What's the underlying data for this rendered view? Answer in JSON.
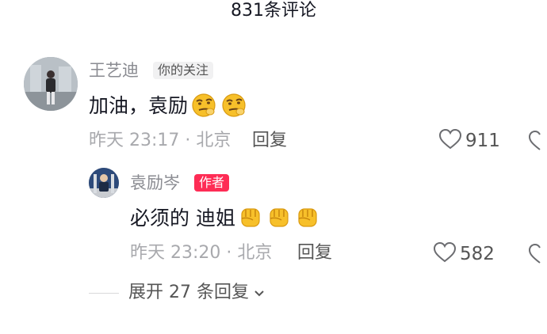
{
  "header": {
    "title": "831条评论"
  },
  "comments": [
    {
      "username": "王艺迪",
      "badge": "你的关注",
      "text": "加油，袁励",
      "emoji_icons": [
        "smirk-emoji-icon",
        "smirk-emoji-icon"
      ],
      "timestamp": "昨天 23:17 · 北京",
      "reply_label": "回复",
      "likes": "911"
    }
  ],
  "replies": [
    {
      "username": "袁励岑",
      "badge": "作者",
      "text": "必须的 迪姐",
      "emoji_icons": [
        "raised-fist-icon",
        "raised-fist-icon",
        "raised-fist-icon"
      ],
      "timestamp": "昨天 23:20 · 北京",
      "reply_label": "回复",
      "likes": "582"
    }
  ],
  "expand": {
    "label": "展开 27 条回复"
  },
  "colors": {
    "author_badge": "#fe2c55",
    "meta_text": "#a8a9ad",
    "username": "#8a8b91"
  }
}
